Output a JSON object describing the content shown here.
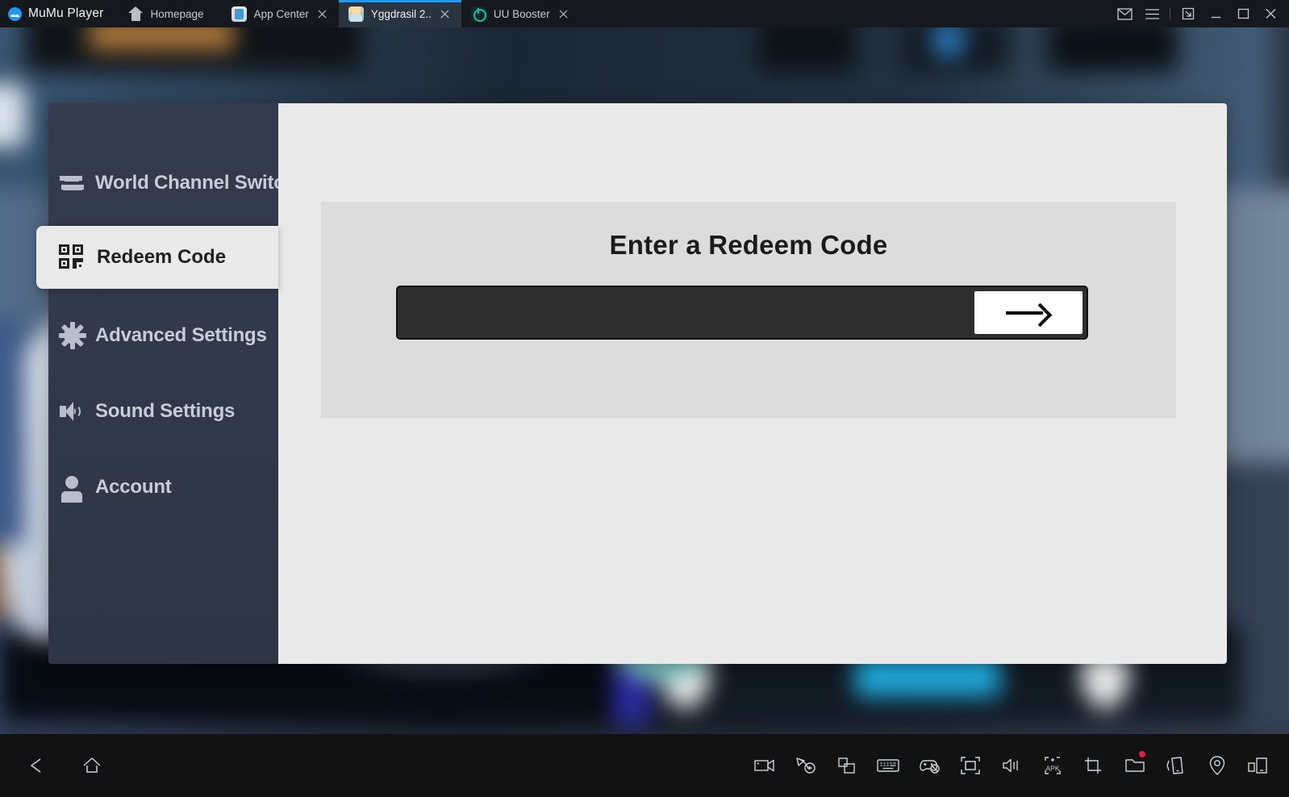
{
  "titlebar": {
    "brand": "MuMu Player",
    "brand_icon": "mumu-logo-icon",
    "tabs": [
      {
        "label": "Homepage",
        "icon": "home-icon",
        "active": false,
        "closable": false
      },
      {
        "label": "App Center",
        "icon": "app-center-favicon",
        "active": false,
        "closable": true
      },
      {
        "label": "Yggdrasil 2..",
        "icon": "yggdrasil-favicon",
        "active": true,
        "closable": true
      },
      {
        "label": "UU Booster",
        "icon": "uu-booster-favicon",
        "active": false,
        "closable": true
      }
    ],
    "window_controls": [
      {
        "name": "mail-icon",
        "glyph": "envelope"
      },
      {
        "name": "hamburger-menu-icon",
        "glyph": "menu"
      },
      {
        "name": "divider",
        "glyph": "divider"
      },
      {
        "name": "detach-window-icon",
        "glyph": "detach"
      },
      {
        "name": "minimize-icon",
        "glyph": "minimize"
      },
      {
        "name": "maximize-icon",
        "glyph": "maximize"
      },
      {
        "name": "close-icon",
        "glyph": "close"
      }
    ],
    "accent_color": "#1e9bf0",
    "background_color": "#15181c"
  },
  "sidebar": {
    "background_color": "#323a4c",
    "selected_index": 1,
    "items": [
      {
        "label": "World Channel Switch",
        "icon": "swap-arrows-icon"
      },
      {
        "label": "Redeem Code",
        "icon": "qr-code-icon"
      },
      {
        "label": "Advanced Settings",
        "icon": "gear-icon"
      },
      {
        "label": "Sound Settings",
        "icon": "speaker-icon"
      },
      {
        "label": "Account",
        "icon": "person-icon"
      }
    ]
  },
  "content": {
    "background_color": "#e9e9e9",
    "card": {
      "background_color": "#dcdcdc",
      "title": "Enter a Redeem Code",
      "input": {
        "value": "",
        "placeholder": "",
        "background_color": "#2e2e2e"
      },
      "submit": {
        "icon": "arrow-right-icon",
        "background_color": "#ffffff",
        "label": ""
      }
    }
  },
  "bottombar": {
    "background_color": "#121212",
    "nav": [
      {
        "name": "back-button",
        "icon": "back-triangle-icon"
      },
      {
        "name": "home-button",
        "icon": "home-outline-icon"
      }
    ],
    "tools": [
      {
        "name": "record-video-button",
        "icon": "video-camera-icon",
        "badge": false
      },
      {
        "name": "macro-record-button",
        "icon": "macro-play-icon",
        "badge": false
      },
      {
        "name": "multi-instance-button",
        "icon": "copies-icon",
        "badge": false
      },
      {
        "name": "keyboard-mapping-button",
        "icon": "keyboard-icon",
        "badge": false
      },
      {
        "name": "gamepad-disabled-button",
        "icon": "gamepad-off-icon",
        "badge": false
      },
      {
        "name": "fullscreen-button",
        "icon": "focus-frame-icon",
        "badge": false
      },
      {
        "name": "volume-button",
        "icon": "volume-icon",
        "badge": false
      },
      {
        "name": "install-apk-button",
        "icon": "apk-install-icon",
        "badge": false
      },
      {
        "name": "screenshot-button",
        "icon": "crop-icon",
        "badge": false
      },
      {
        "name": "file-manager-button",
        "icon": "folder-icon",
        "badge": true
      },
      {
        "name": "shake-button",
        "icon": "shake-phone-icon",
        "badge": false
      },
      {
        "name": "location-button",
        "icon": "location-pin-icon",
        "badge": false
      },
      {
        "name": "rotate-screen-button",
        "icon": "rotate-phone-icon",
        "badge": false
      }
    ]
  }
}
